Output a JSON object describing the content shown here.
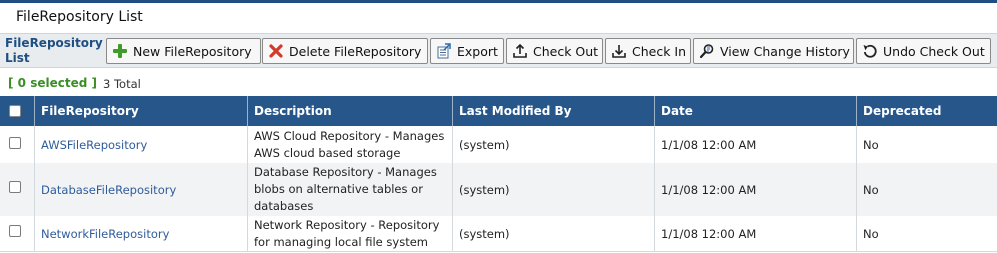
{
  "page": {
    "title": "FileRepository List",
    "accent_color": "#1f4f82"
  },
  "toolbar": {
    "label": "FileRepository List",
    "buttons": [
      {
        "label": "New FileRepository",
        "icon": "plus-icon"
      },
      {
        "label": "Delete FileRepository",
        "icon": "delete-x-icon"
      },
      {
        "label": "Export",
        "icon": "export-icon"
      },
      {
        "label": "Check Out",
        "icon": "check-out-icon"
      },
      {
        "label": "Check In",
        "icon": "check-in-icon"
      },
      {
        "label": "View Change History",
        "icon": "change-history-icon"
      },
      {
        "label": "Undo Check Out",
        "icon": "undo-icon"
      }
    ]
  },
  "selection": {
    "selected_text": "[ 0 selected ]",
    "total_text": "3 Total"
  },
  "table": {
    "header_color": "#27578a",
    "columns": [
      "FileRepository",
      "Description",
      "Last Modified By",
      "Date",
      "Deprecated"
    ],
    "rows": [
      {
        "name": "AWSFileRepository",
        "description": "AWS Cloud Repository - Manages AWS cloud based storage",
        "last_modified_by": "(system)",
        "date": "1/1/08 12:00 AM",
        "deprecated": "No",
        "checked": false
      },
      {
        "name": "DatabaseFileRepository",
        "description": "Database Repository - Manages blobs on alternative tables or databases",
        "last_modified_by": "(system)",
        "date": "1/1/08 12:00 AM",
        "deprecated": "No",
        "checked": false
      },
      {
        "name": "NetworkFileRepository",
        "description": "Network Repository - Repository for managing local file system",
        "last_modified_by": "(system)",
        "date": "1/1/08 12:00 AM",
        "deprecated": "No",
        "checked": false
      }
    ]
  }
}
